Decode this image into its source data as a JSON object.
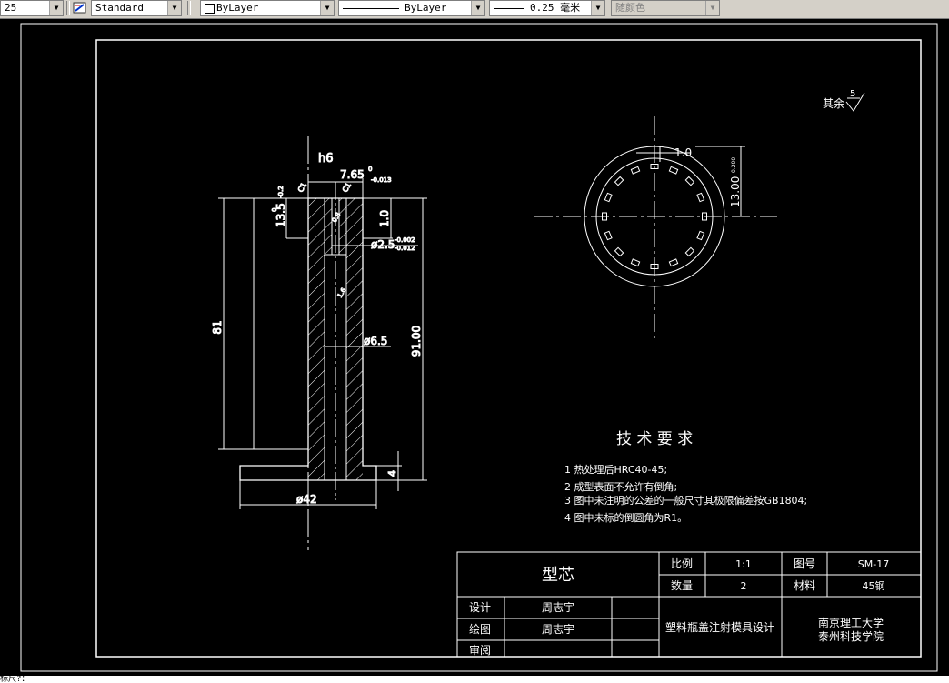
{
  "toolbar": {
    "textstyle_value": "25",
    "dimstyle_value": "Standard",
    "color_value": "ByLayer",
    "linetype_value": "ByLayer",
    "lineweight_value": "0.25 毫米",
    "plotstyle_value": "随颜色"
  },
  "drawing": {
    "roughness_label": "其余",
    "roughness_value": "5",
    "dims": {
      "h6": "h6",
      "d765": "7.65",
      "d765_tol_up": "0",
      "d765_tol_dn": "-0.013",
      "d135": "13.5",
      "d135_tol_up": "0",
      "d135_tol_dn": "-0.2",
      "d10": "1.0",
      "d25": "ø2.5",
      "d25_tol_up": "-0.002",
      "d25_tol_dn": "-0.012",
      "d65": "ø6.5",
      "d81": "81",
      "d9100": "91.00",
      "d4": "4",
      "d42": "ø42",
      "c1": "C1",
      "c2": "C1",
      "c3": "0.8",
      "c4": "1.6",
      "c5": "0.8",
      "top_10": "1.0",
      "right_1300": "13.00",
      "right_tol": "0.200"
    }
  },
  "tech_req": {
    "title": "技 术 要 求",
    "items": [
      "1  热处理后HRC40-45;",
      "2  成型表面不允许有倒角;",
      "3  图中未注明的公差的一般尺寸其极限偏差按GB1804;",
      "4  图中未标的倒圆角为R1。"
    ]
  },
  "title_block": {
    "part_name": "型芯",
    "scale_label": "比例",
    "scale_value": "1:1",
    "drawing_no_label": "图号",
    "drawing_no_value": "SM-17",
    "qty_label": "数量",
    "qty_value": "2",
    "material_label": "材料",
    "material_value": "45钢",
    "design_label": "设计",
    "design_value": "周志宇",
    "draw_label": "绘图",
    "draw_value": "周志宇",
    "review_label": "审阅",
    "project": "塑料瓶盖注射模具设计",
    "school_line1": "南京理工大学",
    "school_line2": "泰州科技学院"
  },
  "cmdline": {
    "text": "标尺?："
  },
  "colors": {
    "background": "#000000",
    "lines": "#ffffff",
    "toolbar": "#d4d0c8"
  }
}
